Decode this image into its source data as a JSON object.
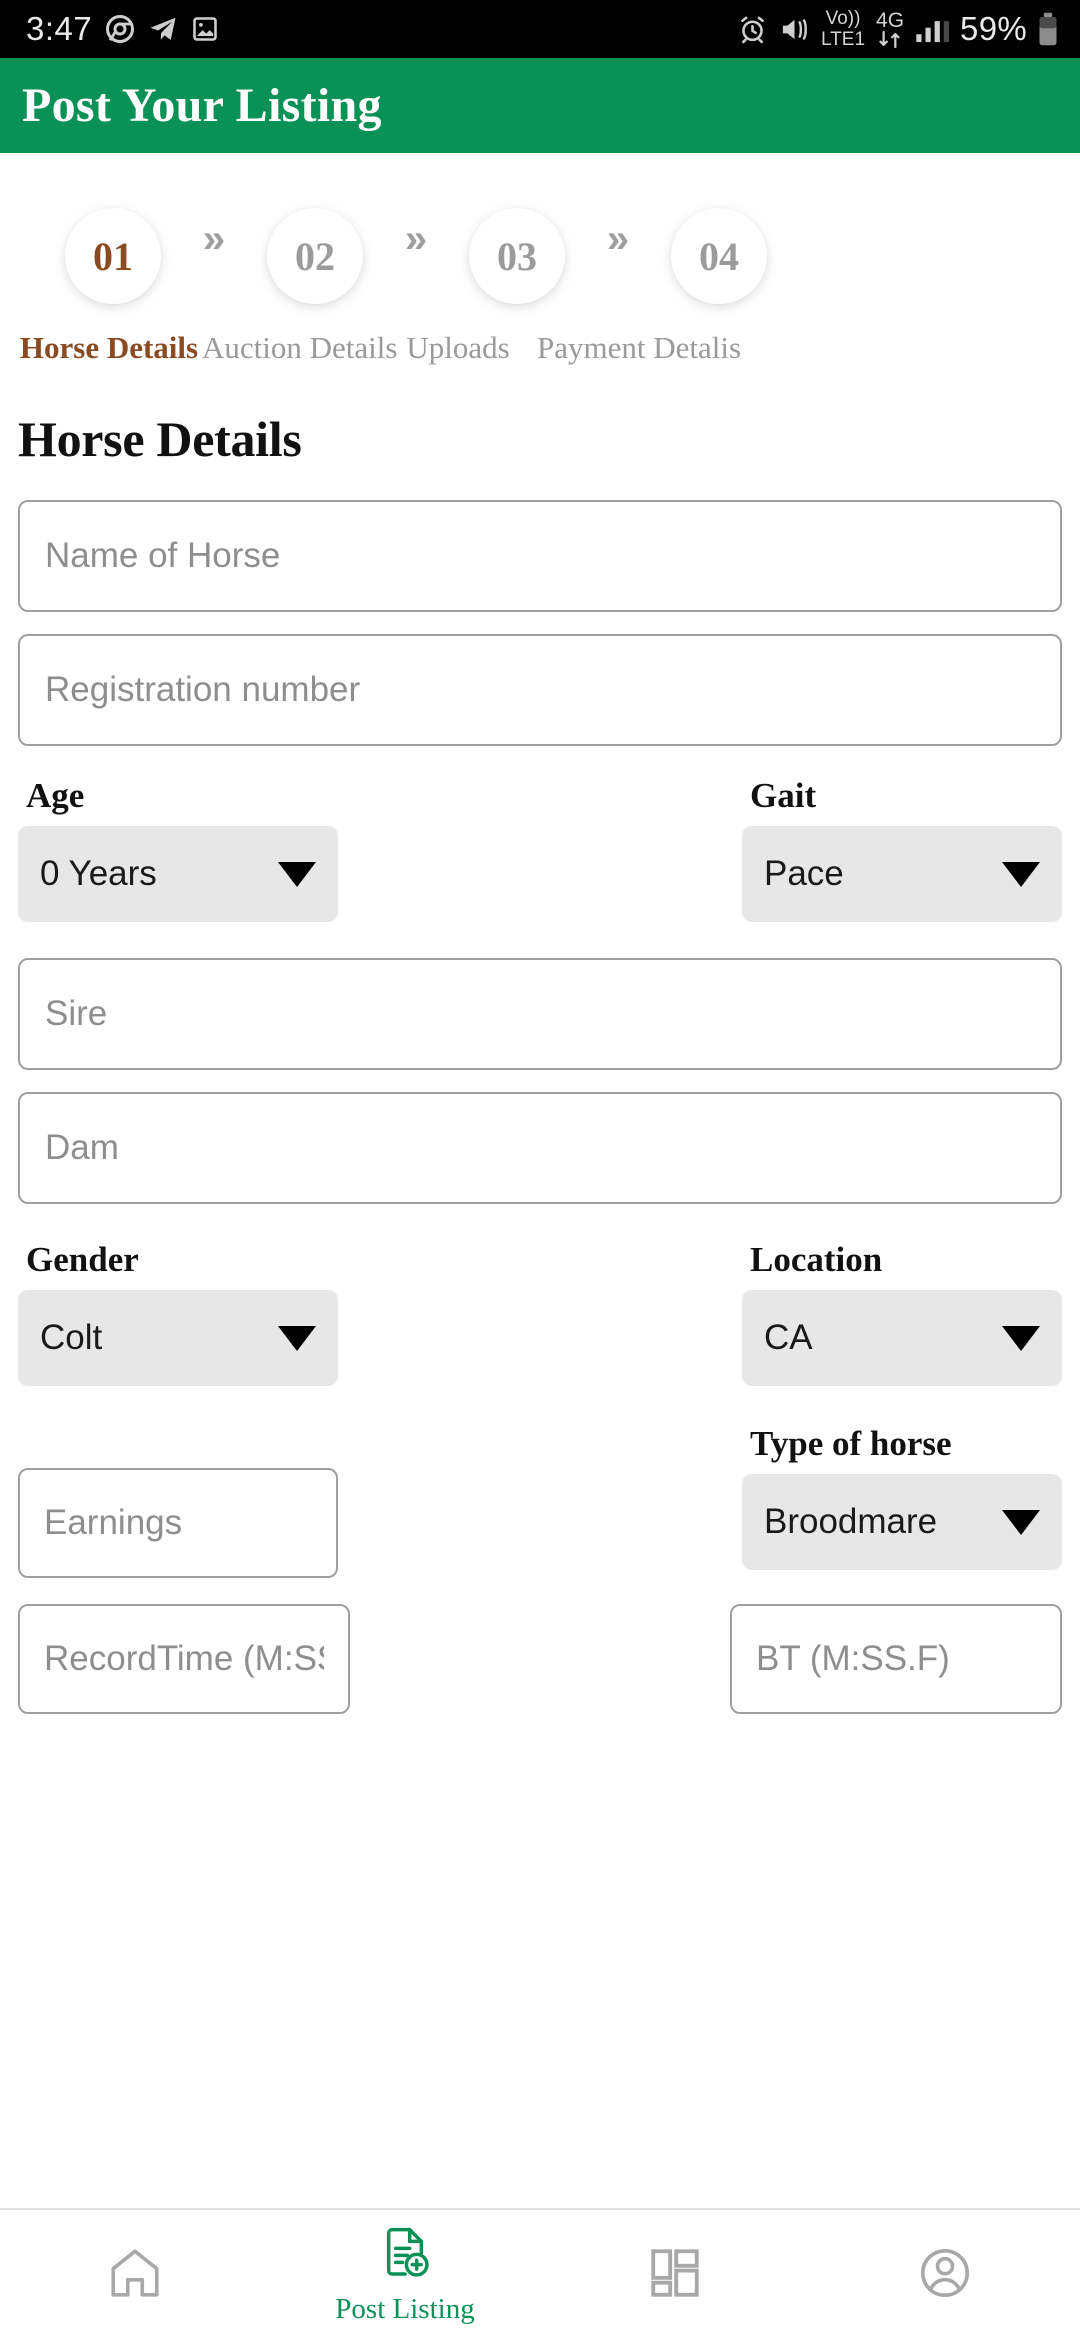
{
  "statusbar": {
    "time": "3:47",
    "left_icons": [
      "chrome-icon",
      "telegram-icon",
      "gallery-icon"
    ],
    "volte_top": "Vo))",
    "volte_bottom": "LTE1",
    "network": "4G",
    "battery_percent": "59%",
    "right_icons": [
      "alarm-icon",
      "vibrate-icon",
      "volte-icon",
      "network-4g-icon",
      "signal-icon",
      "battery-icon"
    ]
  },
  "header": {
    "title": "Post Your Listing",
    "background_color": "#0a9156"
  },
  "stepper": {
    "active_color": "#8a4a22",
    "inactive_color": "#9a9a9a",
    "separator": "»",
    "steps": [
      {
        "number": "01",
        "label": "Horse Details",
        "active": true
      },
      {
        "number": "02",
        "label": "Auction Details",
        "active": false
      },
      {
        "number": "03",
        "label": "Uploads",
        "active": false
      },
      {
        "number": "04",
        "label": "Payment Detalis",
        "active": false
      }
    ]
  },
  "form": {
    "section_title": "Horse Details",
    "name_placeholder": "Name of Horse",
    "registration_placeholder": "Registration number",
    "age_label": "Age",
    "age_value": "0 Years",
    "gait_label": "Gait",
    "gait_value": "Pace",
    "sire_placeholder": "Sire",
    "dam_placeholder": "Dam",
    "gender_label": "Gender",
    "gender_value": "Colt",
    "location_label": "Location",
    "location_value": "CA",
    "earnings_placeholder": "Earnings",
    "type_label": "Type of horse",
    "type_value": "Broodmare",
    "record_time_placeholder": "RecordTime (M:SS....",
    "bt_placeholder": "BT (M:SS.F)"
  },
  "bottomnav": {
    "active_color": "#0a9156",
    "inactive_color": "#a8a8a8",
    "items": [
      {
        "icon": "home-icon",
        "label": "",
        "active": false
      },
      {
        "icon": "post-listing-icon",
        "label": "Post Listing",
        "active": true
      },
      {
        "icon": "dashboard-grid-icon",
        "label": "",
        "active": false
      },
      {
        "icon": "profile-icon",
        "label": "",
        "active": false
      }
    ]
  }
}
